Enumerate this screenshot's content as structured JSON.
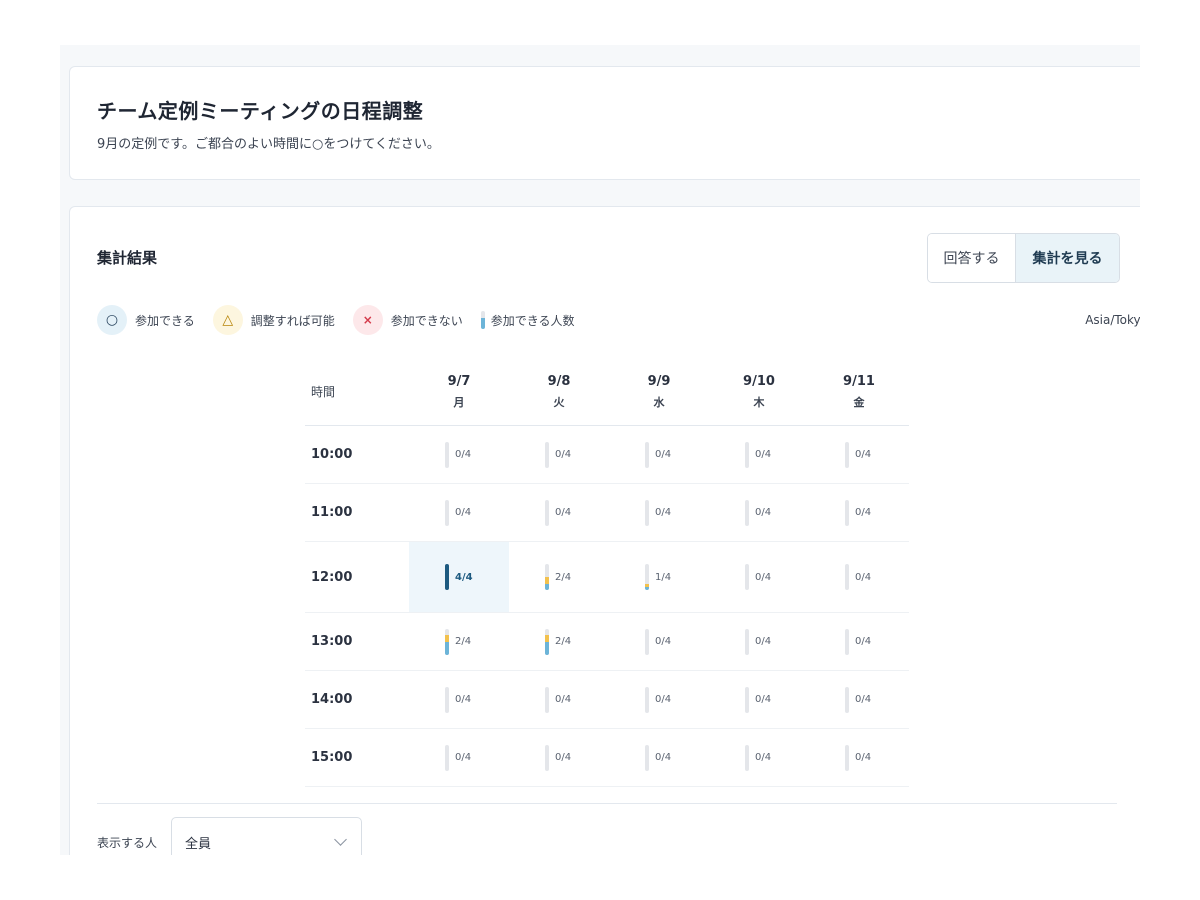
{
  "header": {
    "title": "チーム定例ミーティングの日程調整",
    "description": "9月の定例です。ご都合のよい時間に○をつけてください。"
  },
  "results": {
    "title": "集計結果",
    "tabs": {
      "answer": "回答する",
      "summary": "集計を見る"
    },
    "legend": {
      "ok": {
        "icon": "○",
        "label": "参加できる"
      },
      "maybe": {
        "icon": "△",
        "label": "調整すれば可能"
      },
      "ng": {
        "icon": "×",
        "label": "参加できない"
      },
      "count": {
        "label": "参加できる人数"
      }
    },
    "timezone": "Asia/Tokyo",
    "time_header": "時間",
    "days": [
      {
        "date": "9/7",
        "weekday": "月"
      },
      {
        "date": "9/8",
        "weekday": "火"
      },
      {
        "date": "9/9",
        "weekday": "水"
      },
      {
        "date": "9/10",
        "weekday": "木"
      },
      {
        "date": "9/11",
        "weekday": "金"
      }
    ],
    "total": 4,
    "rows": [
      {
        "time": "10:00",
        "cells": [
          {
            "text": "0/4",
            "ok": 0,
            "maybe": 0
          },
          {
            "text": "0/4",
            "ok": 0,
            "maybe": 0
          },
          {
            "text": "0/4",
            "ok": 0,
            "maybe": 0
          },
          {
            "text": "0/4",
            "ok": 0,
            "maybe": 0
          },
          {
            "text": "0/4",
            "ok": 0,
            "maybe": 0
          }
        ]
      },
      {
        "time": "11:00",
        "cells": [
          {
            "text": "0/4",
            "ok": 0,
            "maybe": 0
          },
          {
            "text": "0/4",
            "ok": 0,
            "maybe": 0
          },
          {
            "text": "0/4",
            "ok": 0,
            "maybe": 0
          },
          {
            "text": "0/4",
            "ok": 0,
            "maybe": 0
          },
          {
            "text": "0/4",
            "ok": 0,
            "maybe": 0
          }
        ]
      },
      {
        "time": "12:00",
        "cells": [
          {
            "text": "4/4",
            "ok": 4,
            "maybe": 0,
            "best": true
          },
          {
            "text": "2/4",
            "ok": 1,
            "maybe": 1
          },
          {
            "text": "1/4",
            "ok": 0.5,
            "maybe": 0.5
          },
          {
            "text": "0/4",
            "ok": 0,
            "maybe": 0
          },
          {
            "text": "0/4",
            "ok": 0,
            "maybe": 0
          }
        ]
      },
      {
        "time": "13:00",
        "cells": [
          {
            "text": "2/4",
            "ok": 2,
            "maybe": 1
          },
          {
            "text": "2/4",
            "ok": 2,
            "maybe": 1
          },
          {
            "text": "0/4",
            "ok": 0,
            "maybe": 0
          },
          {
            "text": "0/4",
            "ok": 0,
            "maybe": 0
          },
          {
            "text": "0/4",
            "ok": 0,
            "maybe": 0
          }
        ]
      },
      {
        "time": "14:00",
        "cells": [
          {
            "text": "0/4",
            "ok": 0,
            "maybe": 0
          },
          {
            "text": "0/4",
            "ok": 0,
            "maybe": 0
          },
          {
            "text": "0/4",
            "ok": 0,
            "maybe": 0
          },
          {
            "text": "0/4",
            "ok": 0,
            "maybe": 0
          },
          {
            "text": "0/4",
            "ok": 0,
            "maybe": 0
          }
        ]
      },
      {
        "time": "15:00",
        "cells": [
          {
            "text": "0/4",
            "ok": 0,
            "maybe": 0
          },
          {
            "text": "0/4",
            "ok": 0,
            "maybe": 0
          },
          {
            "text": "0/4",
            "ok": 0,
            "maybe": 0
          },
          {
            "text": "0/4",
            "ok": 0,
            "maybe": 0
          },
          {
            "text": "0/4",
            "ok": 0,
            "maybe": 0
          }
        ]
      }
    ],
    "filter": {
      "label": "表示する人",
      "value": "全員"
    }
  },
  "colors": {
    "ok": "#6cb4d8",
    "maybe": "#f2c14e",
    "best": "#1d5a80",
    "best_bg": "#eef6fb"
  }
}
